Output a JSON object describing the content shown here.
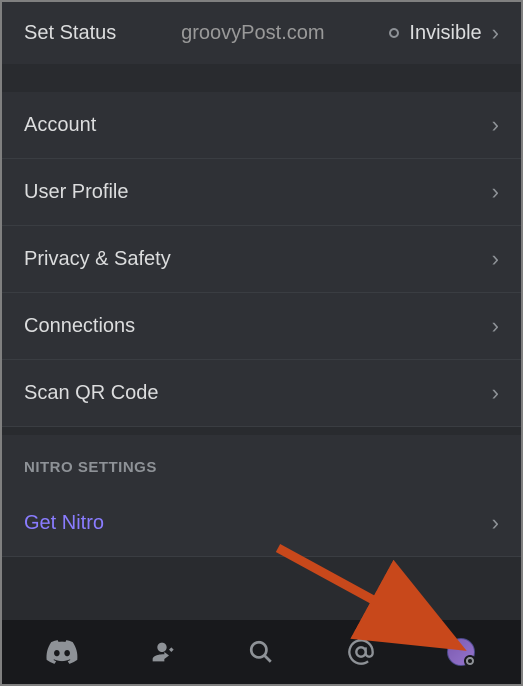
{
  "status": {
    "label": "Set Status",
    "watermark": "groovyPost.com",
    "current": "Invisible"
  },
  "menu": {
    "items": [
      {
        "label": "Account"
      },
      {
        "label": "User Profile"
      },
      {
        "label": "Privacy & Safety"
      },
      {
        "label": "Connections"
      },
      {
        "label": "Scan QR Code"
      }
    ]
  },
  "nitro": {
    "header": "NITRO SETTINGS",
    "item": "Get Nitro"
  }
}
